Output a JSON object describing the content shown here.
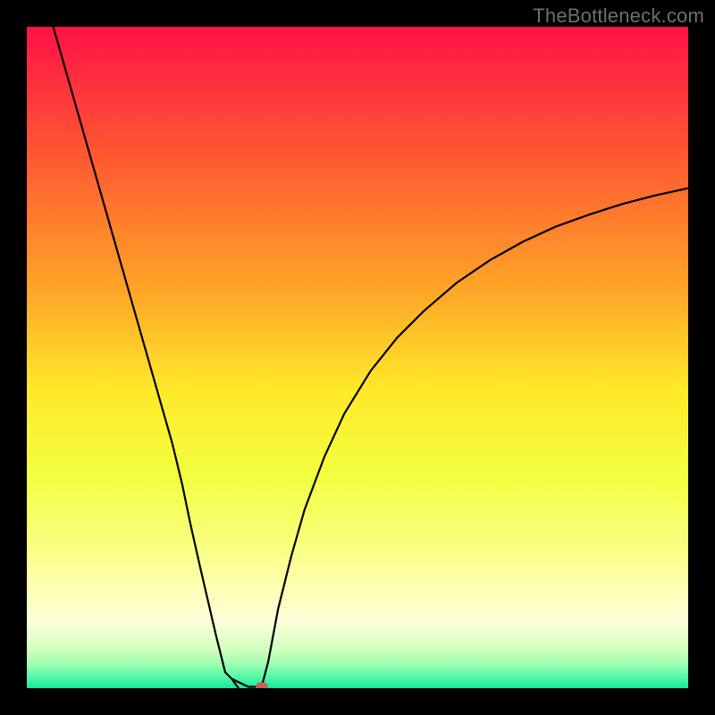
{
  "branding": {
    "watermark": "TheBottleneck.com",
    "watermark_color": "#6e6e6e"
  },
  "colors": {
    "background": "#000000",
    "curve": "#000000",
    "marker": "#c7635a",
    "gradient_stops": [
      {
        "offset": 0.0,
        "color": "#ff1247"
      },
      {
        "offset": 0.2,
        "color": "#ff5a31"
      },
      {
        "offset": 0.4,
        "color": "#ffa628"
      },
      {
        "offset": 0.55,
        "color": "#ffe92a"
      },
      {
        "offset": 0.68,
        "color": "#f2ff40"
      },
      {
        "offset": 0.78,
        "color": "#f8ff7d"
      },
      {
        "offset": 0.84,
        "color": "#ffffad"
      },
      {
        "offset": 0.9,
        "color": "#fbffda"
      },
      {
        "offset": 0.94,
        "color": "#d4ffc0"
      },
      {
        "offset": 0.965,
        "color": "#9bffb0"
      },
      {
        "offset": 0.985,
        "color": "#4cf7a7"
      },
      {
        "offset": 1.0,
        "color": "#18e59d"
      }
    ]
  },
  "chart_data": {
    "type": "line",
    "title": "",
    "xlabel": "",
    "ylabel": "",
    "xlim": [
      0,
      100
    ],
    "ylim": [
      0,
      100
    ],
    "grid": false,
    "legend": false,
    "series": [
      {
        "name": "curve-left",
        "x": [
          4,
          6,
          8,
          10,
          12,
          14,
          16,
          18,
          20,
          22,
          23.5,
          24.7,
          26.0,
          27.3,
          28.6,
          30.0,
          31.0,
          32.0
        ],
        "y": [
          100,
          93,
          86,
          79,
          72,
          65,
          58,
          51,
          44,
          37,
          30.8,
          25.0,
          19.2,
          13.6,
          8.0,
          2.4,
          1.4,
          0.0
        ]
      },
      {
        "name": "curve-flat",
        "x": [
          31.0,
          33.5,
          35.5
        ],
        "y": [
          1.4,
          0.2,
          0.2
        ]
      },
      {
        "name": "curve-right",
        "x": [
          35.5,
          36.5,
          38.0,
          40.0,
          42.0,
          45.0,
          48.0,
          52.0,
          56.0,
          60.0,
          65.0,
          70.0,
          75.0,
          80.0,
          85.0,
          90.0,
          95.0,
          100.0
        ],
        "y": [
          0.2,
          4.0,
          12.0,
          20.0,
          27.0,
          35.0,
          41.5,
          48.0,
          53.0,
          57.0,
          61.3,
          64.7,
          67.5,
          69.8,
          71.6,
          73.2,
          74.5,
          75.6
        ]
      }
    ],
    "markers": [
      {
        "name": "min-marker",
        "x": 35.5,
        "y": 0.2
      }
    ]
  }
}
